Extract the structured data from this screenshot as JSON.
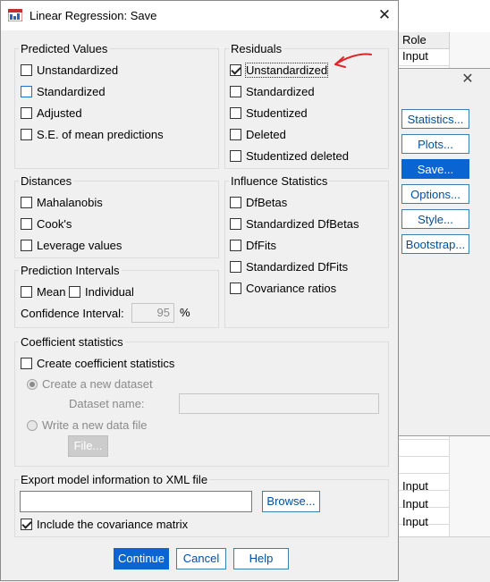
{
  "background_app": {
    "grid_header": "Role",
    "cells_top": [
      "Input"
    ],
    "cells_bottom": [
      "Input",
      "Input",
      "Input"
    ]
  },
  "parent_dialog": {
    "buttons": [
      "Statistics...",
      "Plots...",
      "Save...",
      "Options...",
      "Style...",
      "Bootstrap..."
    ],
    "active_button": "Save..."
  },
  "dialog": {
    "title": "Linear Regression: Save",
    "predicted_values": {
      "legend": "Predicted Values",
      "items": [
        {
          "label": "Unstandardized",
          "checked": false
        },
        {
          "label": "Standardized",
          "checked": false
        },
        {
          "label": "Adjusted",
          "checked": false
        },
        {
          "label": "S.E. of mean predictions",
          "checked": false
        }
      ]
    },
    "residuals": {
      "legend": "Residuals",
      "items": [
        {
          "label": "Unstandardized",
          "checked": true
        },
        {
          "label": "Standardized",
          "checked": false
        },
        {
          "label": "Studentized",
          "checked": false
        },
        {
          "label": "Deleted",
          "checked": false
        },
        {
          "label": "Studentized deleted",
          "checked": false
        }
      ]
    },
    "distances": {
      "legend": "Distances",
      "items": [
        {
          "label": "Mahalanobis",
          "checked": false
        },
        {
          "label": "Cook's",
          "checked": false
        },
        {
          "label": "Leverage values",
          "checked": false
        }
      ]
    },
    "influence_statistics": {
      "legend": "Influence Statistics",
      "items": [
        {
          "label": "DfBetas",
          "checked": false
        },
        {
          "label": "Standardized DfBetas",
          "checked": false
        },
        {
          "label": "DfFits",
          "checked": false
        },
        {
          "label": "Standardized DfFits",
          "checked": false
        },
        {
          "label": "Covariance ratios",
          "checked": false
        }
      ]
    },
    "prediction_intervals": {
      "legend": "Prediction Intervals",
      "mean_label": "Mean",
      "individual_label": "Individual",
      "confidence_label": "Confidence Interval:",
      "confidence_value": "95",
      "percent": "%"
    },
    "coefficient_statistics": {
      "legend": "Coefficient statistics",
      "create_label": "Create coefficient statistics",
      "new_dataset_label": "Create a new dataset",
      "dataset_name_label": "Dataset name:",
      "dataset_name_value": "",
      "write_file_label": "Write a new data file",
      "file_button": "File..."
    },
    "export": {
      "legend": "Export model information to XML file",
      "path_value": "",
      "browse_button": "Browse...",
      "include_cov_label": "Include the covariance matrix",
      "include_cov_checked": true
    },
    "footer": {
      "continue": "Continue",
      "cancel": "Cancel",
      "help": "Help"
    }
  },
  "colors": {
    "accent": "#0a64d2",
    "button_border": "#3c7fb1",
    "annotation_arrow": "#e0242a"
  }
}
